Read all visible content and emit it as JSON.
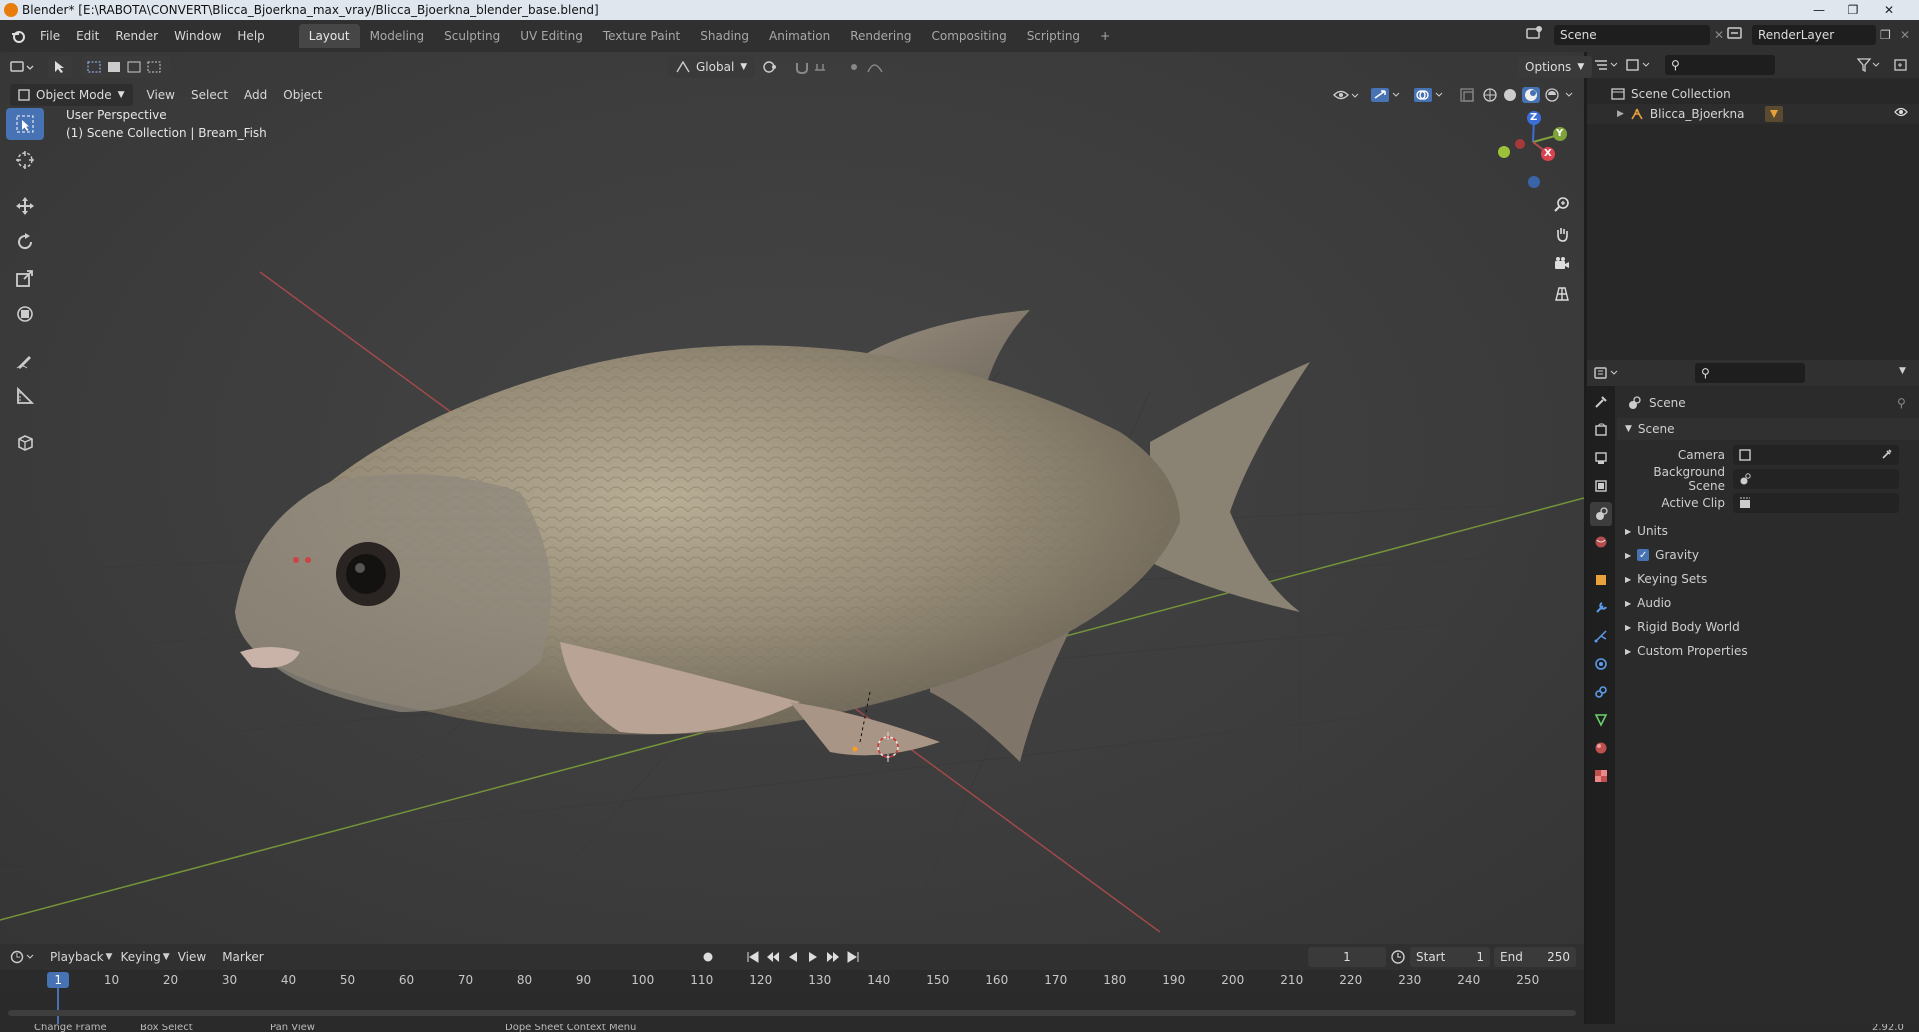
{
  "titlebar": {
    "title": "Blender* [E:\\RABOTA\\CONVERT\\Blicca_Bjoerkna_max_vray/Blicca_Bjoerkna_blender_base.blend]"
  },
  "menu": {
    "items": [
      "File",
      "Edit",
      "Render",
      "Window",
      "Help"
    ]
  },
  "workspaces": {
    "tabs": [
      "Layout",
      "Modeling",
      "Sculpting",
      "UV Editing",
      "Texture Paint",
      "Shading",
      "Animation",
      "Rendering",
      "Compositing",
      "Scripting"
    ],
    "active": "Layout"
  },
  "scene_field": "Scene",
  "renderlayer_field": "RenderLayer",
  "viewport_header": {
    "mode": "Object Mode",
    "menus": [
      "View",
      "Select",
      "Add",
      "Object"
    ],
    "orientation": "Global",
    "options": "Options"
  },
  "viewport": {
    "perspective": "User Perspective",
    "collection_line": "(1) Scene Collection | Bream_Fish",
    "gizmo": {
      "z": "Z",
      "y": "Y",
      "x": "X"
    }
  },
  "outliner": {
    "scene_collection": "Scene Collection",
    "object": "Blicca_Bjoerkna"
  },
  "properties": {
    "context": "Scene",
    "panel": "Scene",
    "fields": [
      {
        "label": "Camera",
        "value": ""
      },
      {
        "label": "Background Scene",
        "value": ""
      },
      {
        "label": "Active Clip",
        "value": ""
      }
    ],
    "sections": [
      "Units",
      "Gravity",
      "Keying Sets",
      "Audio",
      "Rigid Body World",
      "Custom Properties"
    ],
    "gravity_checked": true
  },
  "timeline": {
    "menus": [
      "Playback",
      "Keying",
      "View",
      "Marker"
    ],
    "current_frame": "1",
    "start_label": "Start",
    "start": "1",
    "end_label": "End",
    "end": "250",
    "ruler": [
      "1",
      "10",
      "20",
      "30",
      "40",
      "50",
      "60",
      "70",
      "80",
      "90",
      "100",
      "110",
      "120",
      "130",
      "140",
      "150",
      "160",
      "170",
      "180",
      "190",
      "200",
      "210",
      "220",
      "230",
      "240",
      "250"
    ]
  },
  "statusbar": {
    "items": [
      "Change Frame",
      "Box Select",
      "Pan View",
      "Dope Sheet Context Menu"
    ],
    "version": "2.92.0"
  },
  "colors": {
    "accent": "#4772b3",
    "x_axis": "#b34c4c",
    "y_axis": "#7fa33a",
    "z_axis": "#3b6fd6",
    "active_frame": "#4772b3"
  }
}
